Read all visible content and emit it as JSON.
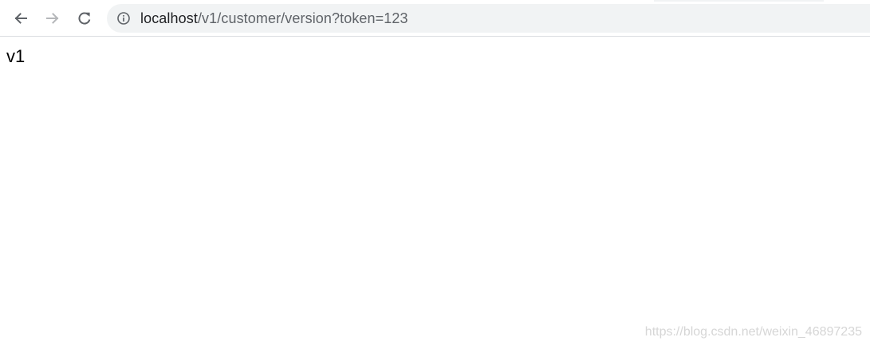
{
  "browser": {
    "url_host": "localhost",
    "url_path": "/v1/customer/version?token=123",
    "icons": {
      "back": "arrow-left-icon",
      "forward": "arrow-right-icon",
      "reload": "reload-icon",
      "site_info": "info-circle-icon"
    }
  },
  "page": {
    "body_text": "v1"
  },
  "watermark": {
    "text": "https://blog.csdn.net/weixin_46897235"
  }
}
